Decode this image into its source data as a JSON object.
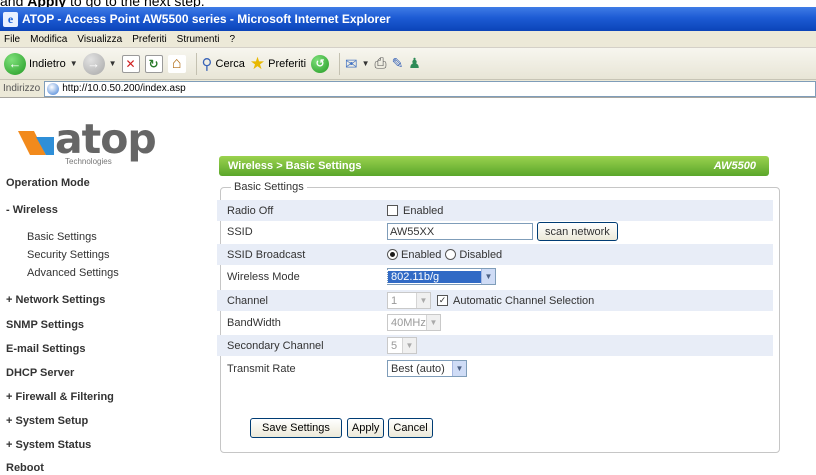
{
  "caption": {
    "prefix": "and ",
    "bold": "Apply",
    "suffix": " to go to the next step."
  },
  "window": {
    "title": "ATOP - Access Point AW5500 series - Microsoft Internet Explorer"
  },
  "menu": [
    "File",
    "Modifica",
    "Visualizza",
    "Preferiti",
    "Strumenti",
    "?"
  ],
  "toolbar": {
    "back": "Indietro",
    "search": "Cerca",
    "favorites": "Preferiti"
  },
  "address": {
    "label": "Indirizzo",
    "url": "http://10.0.50.200/index.asp"
  },
  "logo": {
    "word": "atop",
    "sub": "Technologies"
  },
  "nav": {
    "operation_mode": "Operation Mode",
    "wireless": "- Wireless",
    "basic_settings": "Basic Settings",
    "security_settings": "Security Settings",
    "advanced_settings": "Advanced Settings",
    "network_settings": "+ Network Settings",
    "snmp_settings": "SNMP Settings",
    "email_settings": "E-mail Settings",
    "dhcp_server": "DHCP Server",
    "firewall": "+ Firewall & Filtering",
    "system_setup": "+ System Setup",
    "system_status": "+ System Status",
    "reboot": "Reboot"
  },
  "header": {
    "breadcrumb": "Wireless > Basic Settings",
    "model": "AW5500"
  },
  "form": {
    "legend": "Basic Settings",
    "radio_off": {
      "label": "Radio Off",
      "option": "Enabled"
    },
    "ssid": {
      "label": "SSID",
      "value": "AW55XX",
      "scan": "scan network"
    },
    "ssid_broadcast": {
      "label": "SSID Broadcast",
      "enabled": "Enabled",
      "disabled": "Disabled"
    },
    "wireless_mode": {
      "label": "Wireless Mode",
      "value": "802.11b/g"
    },
    "channel": {
      "label": "Channel",
      "value": "1",
      "auto": "Automatic Channel Selection"
    },
    "bandwidth": {
      "label": "BandWidth",
      "value": "40MHz"
    },
    "secondary_channel": {
      "label": "Secondary Channel",
      "value": "5"
    },
    "transmit_rate": {
      "label": "Transmit Rate",
      "value": "Best (auto)"
    }
  },
  "actions": {
    "save": "Save Settings",
    "apply": "Apply",
    "cancel": "Cancel"
  },
  "colors": {
    "section_bar": "#5aa62a",
    "titlebar": "#1d5bd4",
    "row_alt": "#e8edf7",
    "logo_orange": "#f28a1c",
    "logo_blue": "#2f8fd8"
  }
}
